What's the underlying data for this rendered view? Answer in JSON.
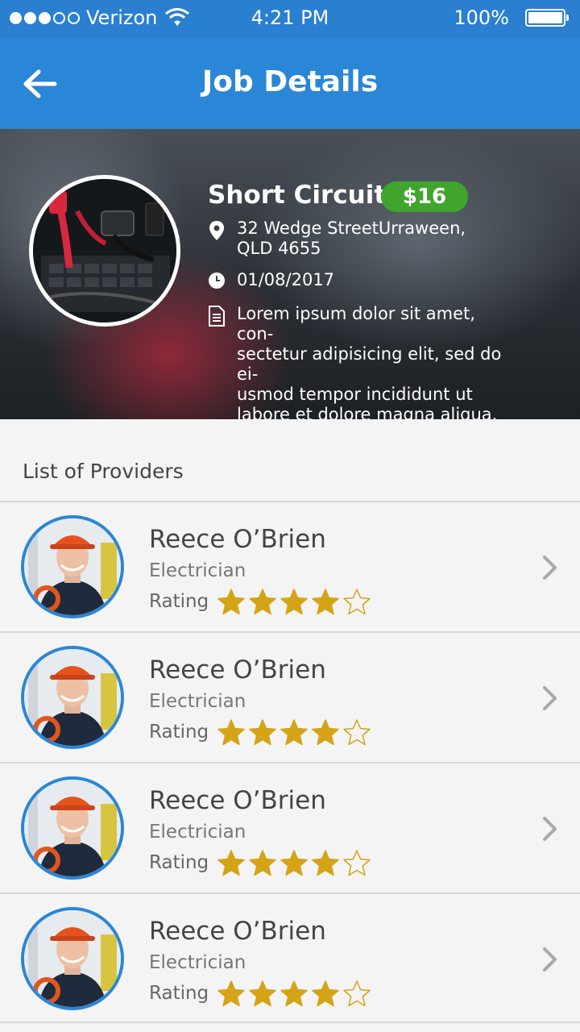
{
  "status_bar": {
    "signal_dots_filled": 3,
    "signal_dots_total": 5,
    "carrier": "Verizon",
    "time": "4:21 PM",
    "battery": "100%",
    "icons": [
      "signal-icon",
      "wifi-icon",
      "battery-icon"
    ]
  },
  "app_bar": {
    "title": "Job Details",
    "back_icon": "back-arrow-icon"
  },
  "job": {
    "title": "Short Circuit",
    "price": "$16",
    "address_line1": "32 Wedge StreetUrraween,",
    "address_line2": "QLD 4655",
    "date": "01/08/2017",
    "description_lines": [
      "Lorem ipsum dolor sit amet, con-",
      "sectetur adipisicing elit, sed do ei-",
      "usmod tempor incididunt ut",
      "labore et dolore magna aliqua. Ut"
    ],
    "icons": [
      "location-pin-icon",
      "clock-icon",
      "document-icon"
    ]
  },
  "providers_section": {
    "title": "List of Providers",
    "rating_label": "Rating",
    "items": [
      {
        "name": "Reece O’Brien",
        "role": "Electrician",
        "rating": 4,
        "max_rating": 5
      },
      {
        "name": "Reece O’Brien",
        "role": "Electrician",
        "rating": 4,
        "max_rating": 5
      },
      {
        "name": "Reece O’Brien",
        "role": "Electrician",
        "rating": 4,
        "max_rating": 5
      },
      {
        "name": "Reece O’Brien",
        "role": "Electrician",
        "rating": 4,
        "max_rating": 5
      }
    ]
  },
  "colors": {
    "primary": "#2a86d6",
    "price_badge": "#3fa52d",
    "star": "#d4a416"
  }
}
